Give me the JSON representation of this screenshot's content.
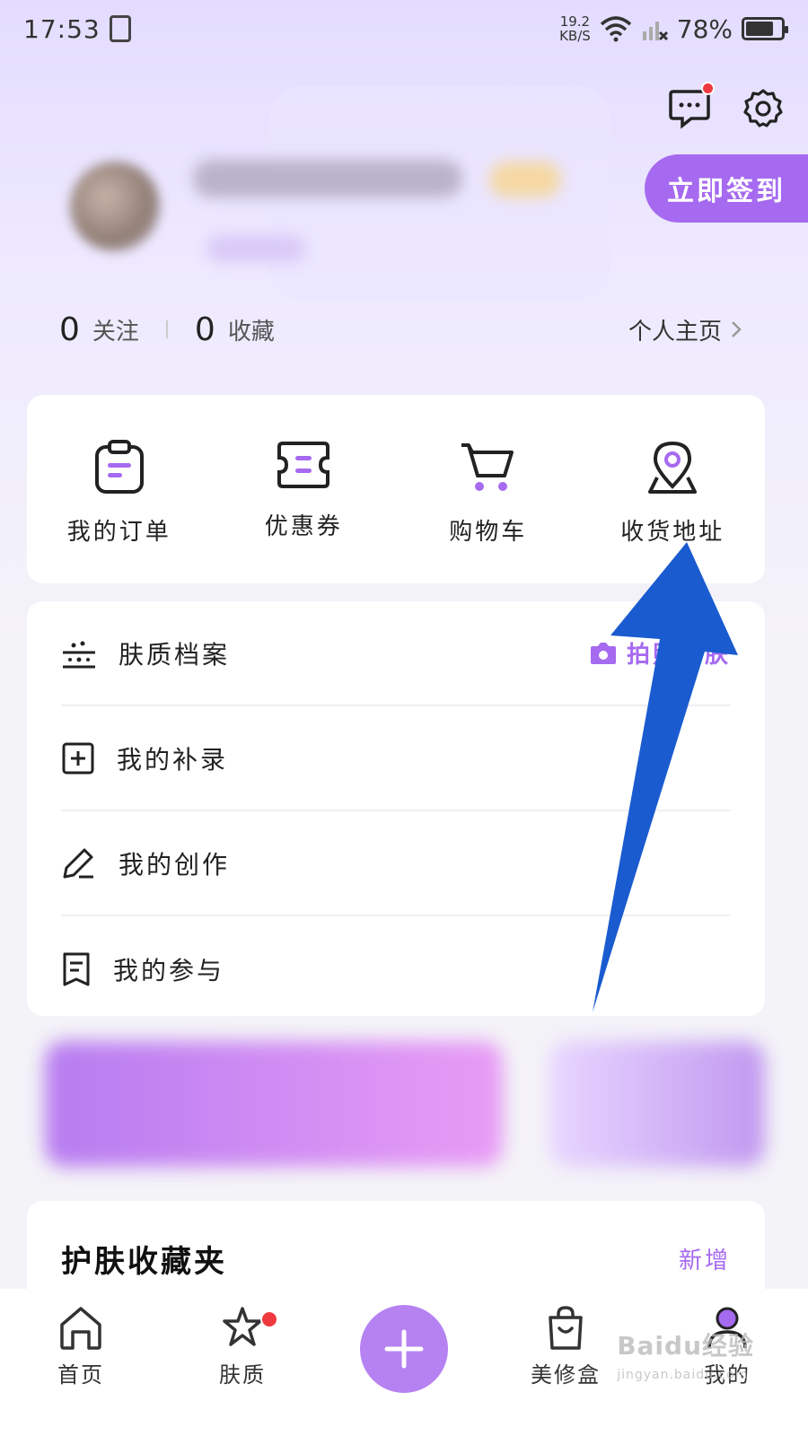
{
  "status_bar": {
    "time": "17:53",
    "speed_value": "19.2",
    "speed_unit": "KB/S",
    "battery": "78%"
  },
  "header": {
    "signin_label": "立即签到"
  },
  "stats": {
    "follow_count": "0",
    "follow_label": "关注",
    "collect_count": "0",
    "collect_label": "收藏",
    "homepage_label": "个人主页"
  },
  "quick_actions": [
    {
      "label": "我的订单",
      "icon": "order-icon"
    },
    {
      "label": "优惠券",
      "icon": "coupon-icon"
    },
    {
      "label": "购物车",
      "icon": "cart-icon"
    },
    {
      "label": "收货地址",
      "icon": "location-icon"
    }
  ],
  "menu": [
    {
      "label": "肤质档案",
      "icon": "skin-profile-icon",
      "right_label": "拍照测肤"
    },
    {
      "label": "我的补录",
      "icon": "add-square-icon"
    },
    {
      "label": "我的创作",
      "icon": "pencil-icon"
    },
    {
      "label": "我的参与",
      "icon": "bookmark-doc-icon"
    }
  ],
  "favorites": {
    "title": "护肤收藏夹",
    "add_label": "新增"
  },
  "tabbar": [
    {
      "label": "首页",
      "icon": "home-icon"
    },
    {
      "label": "肤质",
      "icon": "skin-star-icon"
    },
    {
      "label": "",
      "icon": "plus-icon"
    },
    {
      "label": "美修盒",
      "icon": "bag-icon"
    },
    {
      "label": "我的",
      "icon": "user-icon"
    }
  ],
  "watermark": {
    "brand": "Baidu经验",
    "url": "jingyan.baidu.com"
  },
  "colors": {
    "accent": "#a66af0",
    "notify": "#f0393e",
    "arrow": "#1a5bd0"
  }
}
